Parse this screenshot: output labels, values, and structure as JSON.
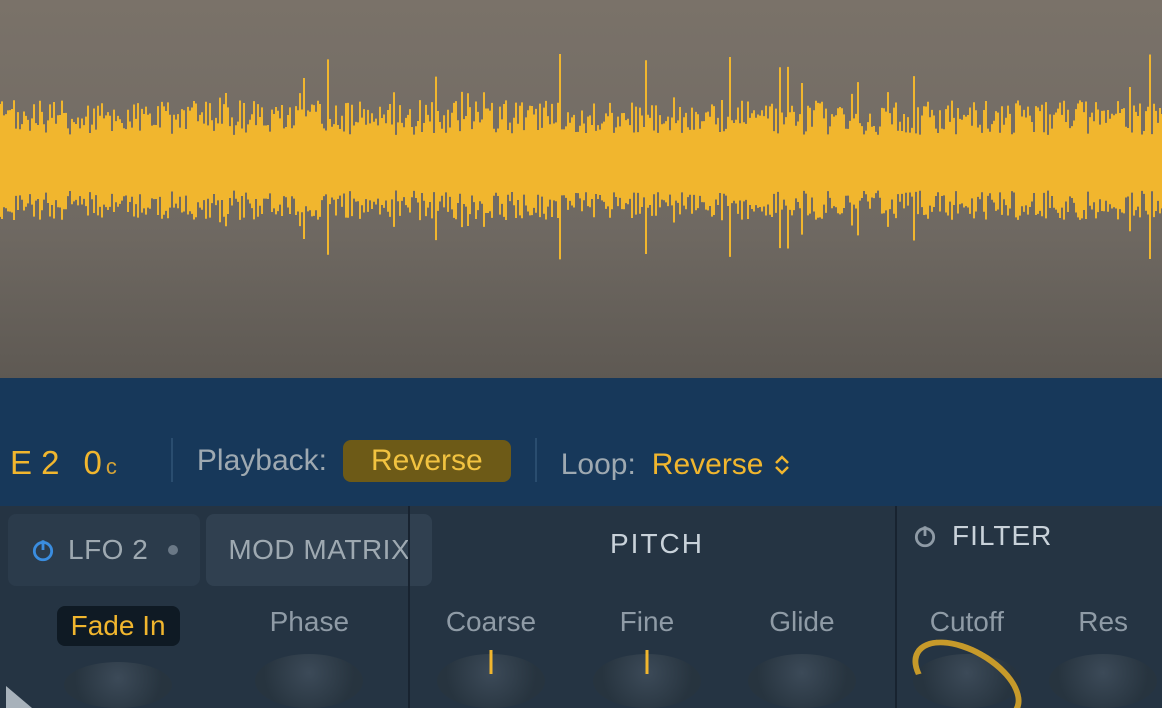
{
  "waveform": {
    "color": "#f1b62e",
    "bg_top": "#7a7269",
    "bg_bottom": "#5e5953"
  },
  "transport": {
    "root_note": "E 2",
    "cents": "0",
    "cents_unit": "c",
    "playback_label": "Playback:",
    "playback_value": "Reverse",
    "loop_label": "Loop:",
    "loop_value": "Reverse"
  },
  "tabs": {
    "lfo2": "LFO 2",
    "modmatrix": "MOD MATRIX"
  },
  "sections": {
    "pitch": "PITCH",
    "filter": "FILTER"
  },
  "knobs": {
    "fade_in": "Fade In",
    "phase": "Phase",
    "coarse": "Coarse",
    "fine": "Fine",
    "glide": "Glide",
    "cutoff": "Cutoff",
    "res": "Res"
  },
  "colors": {
    "accent": "#f1b62e",
    "blue_accent": "#3a8de0"
  }
}
